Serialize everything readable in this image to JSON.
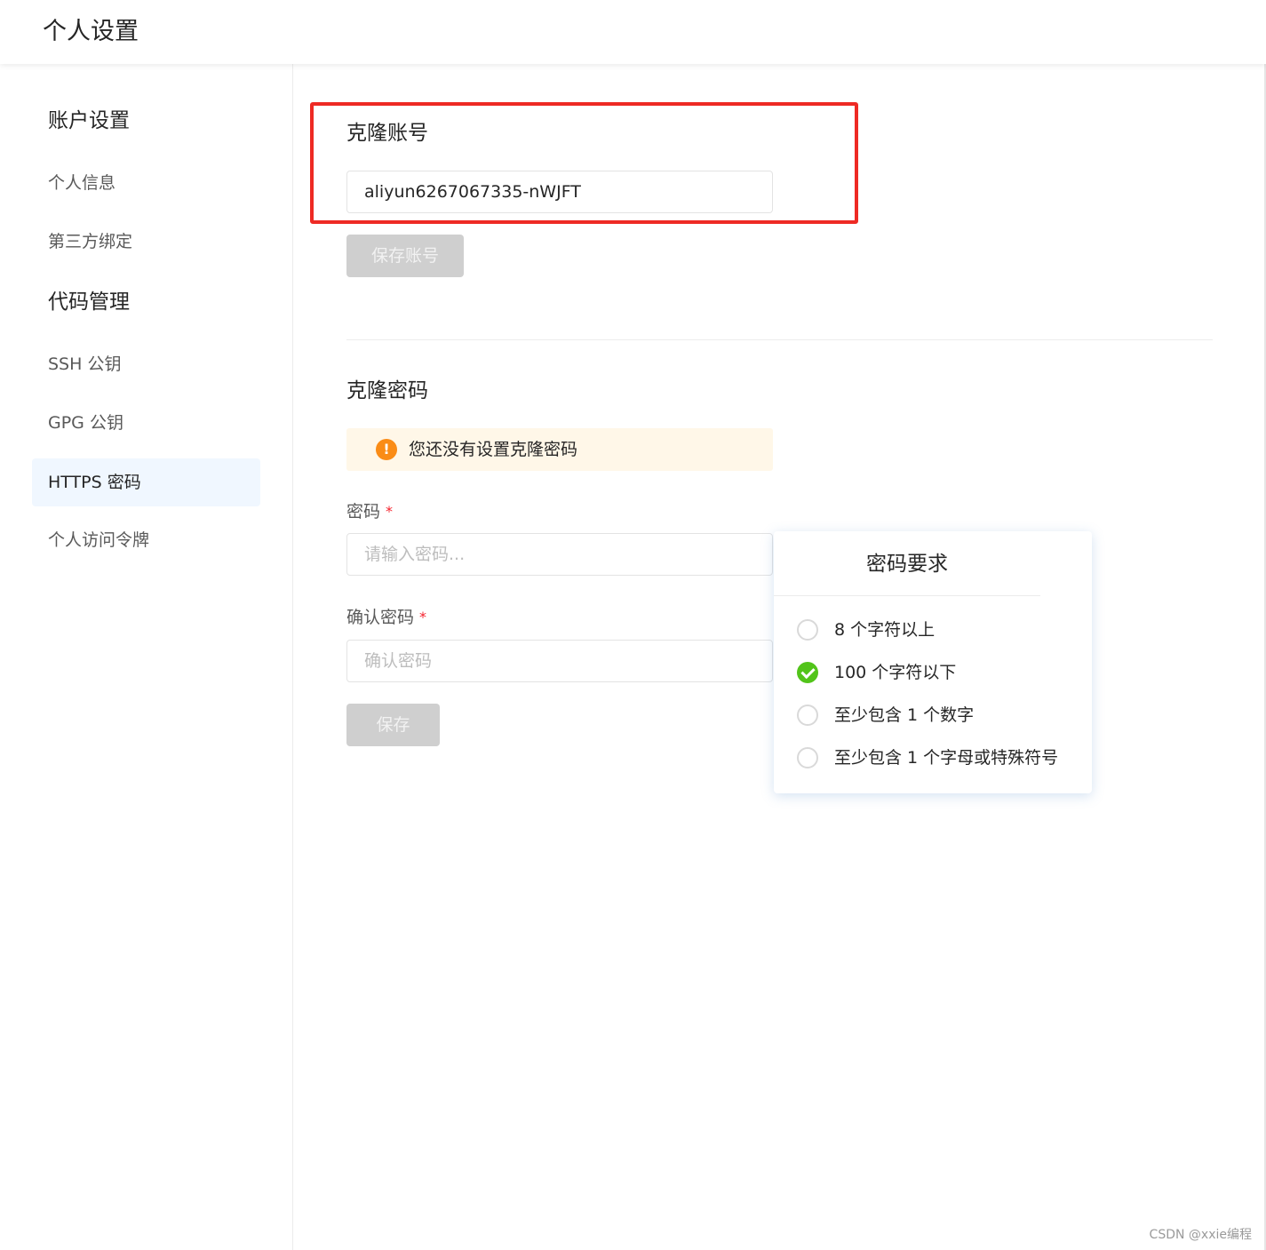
{
  "header": {
    "title": "个人设置"
  },
  "sidebar": {
    "groups": [
      {
        "label": "账户设置"
      },
      {
        "label": "代码管理"
      }
    ],
    "items": [
      {
        "label": "个人信息"
      },
      {
        "label": "第三方绑定"
      },
      {
        "label": "SSH 公钥"
      },
      {
        "label": "GPG 公钥"
      },
      {
        "label": "HTTPS 密码",
        "active": true
      },
      {
        "label": "个人访问令牌"
      }
    ]
  },
  "clone_account": {
    "title": "克隆账号",
    "value": "aliyun6267067335-nWJFT",
    "save_label": "保存账号"
  },
  "clone_password": {
    "title": "克隆密码",
    "alert_text": "您还没有设置克隆密码",
    "password_label": "密码",
    "password_placeholder": "请输入密码...",
    "confirm_label": "确认密码",
    "confirm_placeholder": "确认密码",
    "required_mark": "*",
    "save_label": "保存"
  },
  "requirements": {
    "title": "密码要求",
    "items": [
      {
        "text": "8 个字符以上",
        "met": false
      },
      {
        "text": "100 个字符以下",
        "met": true
      },
      {
        "text": "至少包含 1 个数字",
        "met": false
      },
      {
        "text": "至少包含 1 个字母或特殊符号",
        "met": false
      }
    ]
  },
  "watermark": "CSDN @xxie编程",
  "colors": {
    "highlight_border": "#ee2a24",
    "success": "#52c41a",
    "warning": "#fa8c16",
    "required": "#f5222d",
    "active_nav_bg": "#f0f7ff",
    "alert_bg": "#fff7e8",
    "disabled_button": "#cfcfcf"
  },
  "icons": {
    "alert": "exclamation-circle-icon",
    "requirement_met": "check-circle-icon",
    "requirement_unmet": "empty-circle-icon"
  }
}
